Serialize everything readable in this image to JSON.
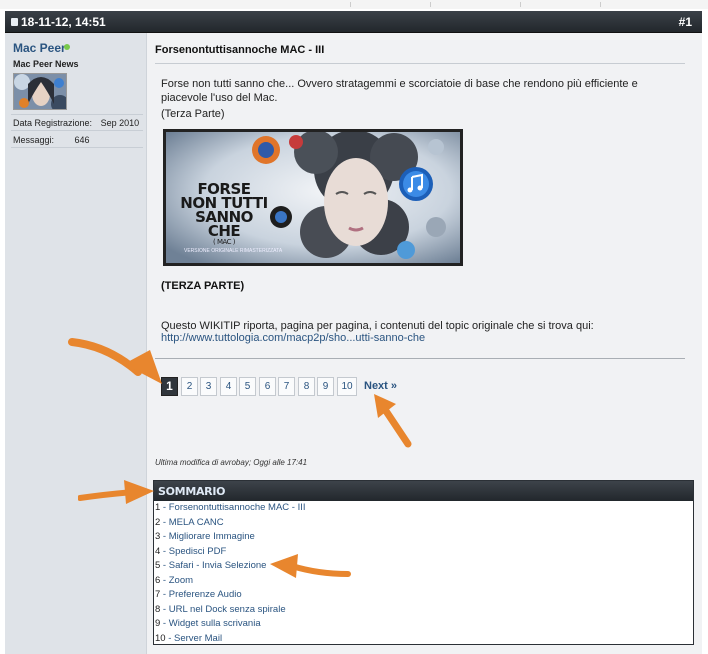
{
  "post": {
    "date": "18-11-12, 14:51",
    "number": "#1"
  },
  "user": {
    "name": "Mac Peer",
    "title": "Mac Peer News",
    "registration_label": "Data Registrazione:",
    "registration_value": "Sep 2010",
    "messages_label": "Messaggi:",
    "messages_value": "646"
  },
  "content": {
    "title": "Forsenontuttisannoche MAC - III",
    "intro": "Forse non tutti sanno che... Ovvero stratagemmi e scorciatoie di base che rendono più efficiente e piacevole l'uso del Mac.",
    "part_note": "(Terza Parte)",
    "banner": {
      "line1": "FORSE",
      "line2": "NON TUTTI",
      "line3": "SANNO",
      "line4": "CHE",
      "line5": "( MAC )",
      "subtitle": "VERSIONE ORIGINALE RIMASTERIZZATA"
    },
    "section_heading": "(TERZA PARTE)",
    "wikitip_text": "Questo WIKITIP riporta, pagina per pagina, i contenuti del topic originale che si trova qui:",
    "link_text": "http://www.tuttologia.com/macp2p/sho...utti-sanno-che"
  },
  "pagination": {
    "pages": [
      "1",
      "2",
      "3",
      "4",
      "5",
      "6",
      "7",
      "8",
      "9",
      "10"
    ],
    "current": "1",
    "next_label": "Next »"
  },
  "edit_note": "Ultima modifica di avrobay; Oggi alle 17:41",
  "sommario": {
    "title": "SOMMARIO",
    "items": [
      {
        "num": "1",
        "label": " - Forsenontuttisannoche MAC - III"
      },
      {
        "num": "2",
        "label": " - MELA CANC"
      },
      {
        "num": "3",
        "label": " - Migliorare Immagine"
      },
      {
        "num": "4",
        "label": " - Spedisci PDF"
      },
      {
        "num": "5",
        "label": " - Safari - Invia Selezione"
      },
      {
        "num": "6",
        "label": " - Zoom"
      },
      {
        "num": "7",
        "label": " - Preferenze Audio"
      },
      {
        "num": "8",
        "label": " - URL nel Dock senza spirale"
      },
      {
        "num": "9",
        "label": " - Widget sulla scrivania"
      },
      {
        "num": "10",
        "label": " - Server Mail"
      }
    ]
  },
  "colors": {
    "header_bg": "#22272c",
    "link": "#2a5480",
    "annotation_arrow": "#e8862e"
  },
  "icons": {
    "date": "document-icon",
    "online": "online-status-icon"
  }
}
